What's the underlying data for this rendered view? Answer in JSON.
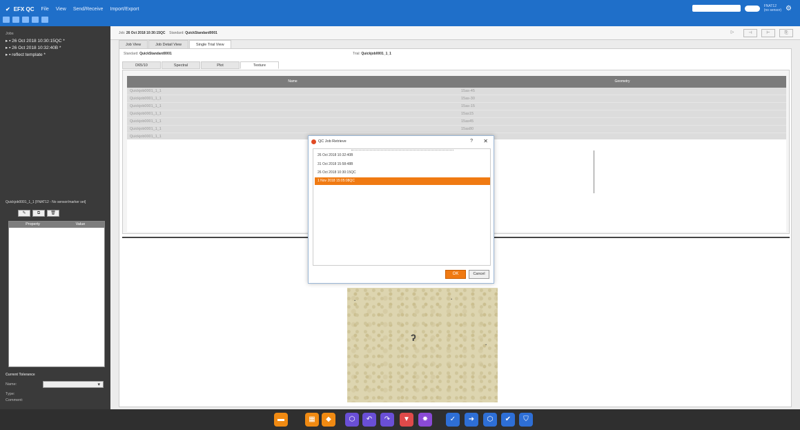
{
  "app": {
    "title": "EFX QC",
    "menu": [
      "File",
      "View",
      "Send/Receive",
      "Import/Export"
    ],
    "device_info_line1": "FNAT12",
    "device_info_line2": "(no sensor)"
  },
  "sidebar": {
    "header": "Jobs",
    "items": [
      "▸ ▪ 26 Oct 2018 10:30:15QC *",
      "▸ ▪ 26 Oct 2018 10:32:40B *",
      "▸ ▪ reflect template *"
    ],
    "selection_info": "Quickjob0001_1_1   [FNAT12 - No sensor/marker set]",
    "buttons": [
      "✎",
      "⧉",
      "🗑"
    ],
    "property_table": {
      "col_property": "Property",
      "col_value": "Value"
    },
    "tolerance": {
      "title": "Current Tolerance",
      "name_label": "Name:",
      "type_label": "Type:",
      "comment_label": "Comment:"
    }
  },
  "infobar": {
    "job_label": "Job:",
    "job_value": "26 Oct 2018 10:30:15QC",
    "standard_label": "Standard:",
    "standard_value": "QuickStandard0001"
  },
  "view_tabs": [
    "Job View",
    "Job Detail View",
    "Single Trial View"
  ],
  "panel": {
    "standard_label": "Standard:",
    "standard_value": "QuickStandard0001",
    "trial_label": "Trial:",
    "trial_value": "Quickjob0001_1_1",
    "sub_tabs": [
      "D65/10",
      "Spectral",
      "Plot",
      "Texture"
    ],
    "grid": {
      "col_name": "Name",
      "col_geometry": "Geometry",
      "rows": [
        {
          "name": "Quickjob0001_1_1",
          "geometry": "15as-45"
        },
        {
          "name": "Quickjob0001_1_1",
          "geometry": "15as-30"
        },
        {
          "name": "Quickjob0001_1_1",
          "geometry": "15as-15"
        },
        {
          "name": "Quickjob0001_1_1",
          "geometry": "15as15"
        },
        {
          "name": "Quickjob0001_1_1",
          "geometry": "15as45"
        },
        {
          "name": "Quickjob0001_1_1",
          "geometry": "15as80"
        },
        {
          "name": "Quickjob0001_1_1",
          "geometry": ""
        }
      ]
    }
  },
  "dialog": {
    "title": "QC Job Retrieve",
    "help": "?",
    "close": "✕",
    "items": [
      "26 Oct 2018 10:32:40B",
      "31 Oct 2018 15:58:48B",
      "26 Oct 2018 10:30:15QC",
      "1 Nov 2018 15:05:08QC"
    ],
    "selected_index": 3,
    "ok_label": "OK",
    "cancel_label": "Cancel"
  },
  "dock": {
    "icons": [
      {
        "name": "folder-icon",
        "color": "#f08a12",
        "glyph": "▬"
      },
      {
        "name": "save-icon",
        "color": "#f08a12",
        "glyph": "▦"
      },
      {
        "name": "tag-icon",
        "color": "#f08a12",
        "glyph": "◆"
      },
      {
        "name": "hexagon-icon",
        "color": "#6a4fd6",
        "glyph": "⬡"
      },
      {
        "name": "undo-icon",
        "color": "#6a4fd6",
        "glyph": "↶"
      },
      {
        "name": "redo-icon",
        "color": "#6a4fd6",
        "glyph": "↷"
      },
      {
        "name": "filter-icon",
        "color": "#e04a4a",
        "glyph": "▼"
      },
      {
        "name": "tools-icon",
        "color": "#8a4ad6",
        "glyph": "✸"
      },
      {
        "name": "check-measure-icon",
        "color": "#2e6fd6",
        "glyph": "✓"
      },
      {
        "name": "import-icon",
        "color": "#2e6fd6",
        "glyph": "➜"
      },
      {
        "name": "shield-outline-icon",
        "color": "#2e6fd6",
        "glyph": "⬡"
      },
      {
        "name": "approve-icon",
        "color": "#2e6fd6",
        "glyph": "✔"
      },
      {
        "name": "shield-check-icon",
        "color": "#2e6fd6",
        "glyph": "⛉"
      }
    ]
  }
}
